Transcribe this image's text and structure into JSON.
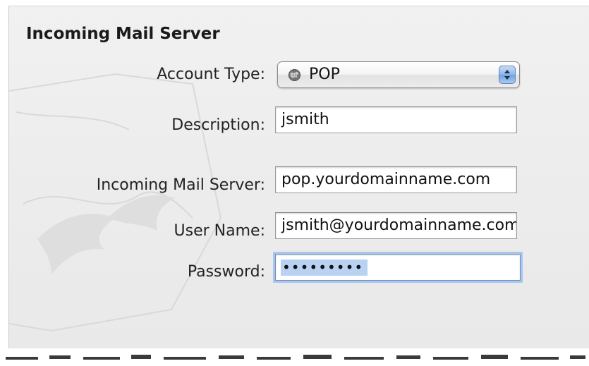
{
  "section": {
    "title": "Incoming Mail Server"
  },
  "account_type": {
    "label": "Account Type:",
    "selected": "POP",
    "icon": "globe-icon"
  },
  "description": {
    "label": "Description:",
    "value": "jsmith"
  },
  "incoming_server": {
    "label": "Incoming Mail Server:",
    "value": "pop.yourdomainname.com"
  },
  "user_name": {
    "label": "User Name:",
    "value": "jsmith@yourdomainname.com"
  },
  "password": {
    "label": "Password:",
    "value": "•••••••••"
  },
  "colors": {
    "panel_background": "#ececec",
    "focus_ring": "#a9c5ec",
    "selection": "#b9d2f2",
    "stepper_accent": "#8db6e8"
  }
}
